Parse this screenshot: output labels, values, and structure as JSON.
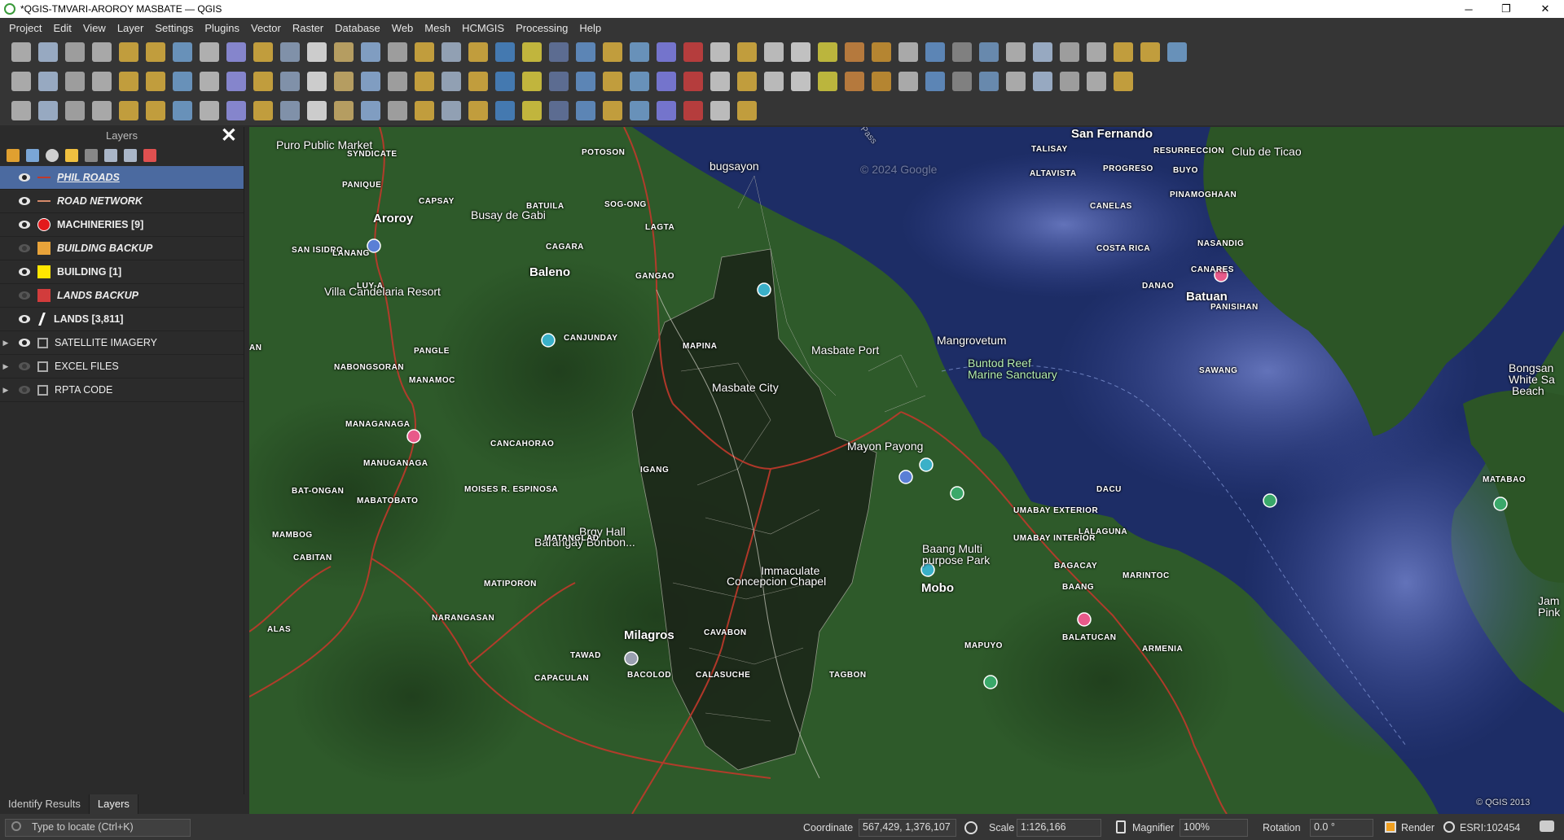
{
  "window": {
    "title": "*QGIS-TMVARI-AROROY MASBATE — QGIS",
    "minimize": "─",
    "maximize": "❐",
    "close": "✕"
  },
  "menu": [
    "Project",
    "Edit",
    "View",
    "Layer",
    "Settings",
    "Plugins",
    "Vector",
    "Raster",
    "Database",
    "Web",
    "Mesh",
    "HCMGIS",
    "Processing",
    "Help"
  ],
  "layers_panel": {
    "title": "Layers",
    "close": "✕",
    "layers": [
      {
        "name": "PHIL ROADS",
        "visible": true,
        "selected": true,
        "style": "line",
        "color": "#c0392b"
      },
      {
        "name": "ROAD NETWORK",
        "visible": true,
        "selected": false,
        "style": "line",
        "color": "#d68a6a"
      },
      {
        "name": "MACHINERIES [9]",
        "visible": true,
        "selected": false,
        "style": "dot",
        "color": "#e31a1c"
      },
      {
        "name": "BUILDING BACKUP",
        "visible": false,
        "selected": false,
        "style": "fill",
        "color": "#e8a33a"
      },
      {
        "name": "BUILDING [1]",
        "visible": true,
        "selected": false,
        "style": "fill",
        "color": "#ffe600"
      },
      {
        "name": "LANDS BACKUP",
        "visible": false,
        "selected": false,
        "style": "fill",
        "color": "#d23c3c"
      },
      {
        "name": "LANDS [3,811]",
        "visible": true,
        "selected": false,
        "style": "pen",
        "color": "#ffffff"
      },
      {
        "name": "SATELLITE IMAGERY",
        "visible": true,
        "selected": false,
        "style": "group",
        "color": "#aaaaaa"
      },
      {
        "name": "EXCEL FILES",
        "visible": false,
        "selected": false,
        "style": "group",
        "color": "#aaaaaa"
      },
      {
        "name": "RPTA CODE",
        "visible": false,
        "selected": false,
        "style": "group",
        "color": "#aaaaaa"
      }
    ]
  },
  "bottom_tabs": [
    "Identify Results",
    "Layers"
  ],
  "map": {
    "big_labels": [
      "San Fernando",
      "Aroroy",
      "Baleno",
      "Batuan",
      "Mobo",
      "Milagros"
    ],
    "place_labels": [
      "Puro Public Market",
      "bugsayon",
      "Busay de Gabi",
      "Villa Candelaria Resort",
      "Masbate Port",
      "Mangrovetum",
      "Buntod Reef",
      "Marine Sanctuary",
      "Mayon Payong",
      "Brgy Hall",
      "Barangay Bonbon...",
      "Baang Multi",
      "purpose Park",
      "Immaculate",
      "Concepcion Chapel",
      "Club de Ticao",
      "Bongsan",
      "White Sa",
      "Beach",
      "Jam",
      "Pink",
      "Masbate City"
    ],
    "barangay_labels": [
      "SYNDICATE",
      "POTOSON",
      "TALISAY",
      "RESURRECCION",
      "ALTAVISTA",
      "PROGRESO",
      "BUYO",
      "PINAMOGHAAN",
      "PANIQUE",
      "CAPSAY",
      "BATUILA",
      "SOG-ONG",
      "LAGTA",
      "CANELAS",
      "SAN ISIDRO",
      "LANANG",
      "CAGARA",
      "COSTA RICA",
      "NASANDIG",
      "GANGAO",
      "CANARES",
      "LUY-A",
      "DANAO",
      "PANISIHAN",
      "CANJUNDAY",
      "PANGLE",
      "NABONGSORAN",
      "MANAMOC",
      "SAWANG",
      "MANAGANAGA",
      "CANCAHORAO",
      "MANUGANAGA",
      "BAT-ONGAN",
      "MABATOBATO",
      "MOISES R. ESPINOSA",
      "IGANG",
      "UMABAY EXTERIOR",
      "DACU",
      "MATABAO",
      "LALAGUNA",
      "UMABAY INTERIOR",
      "MAMBOG",
      "CABITAN",
      "MATANGLAD",
      "BAGACAY",
      "MARINTOC",
      "MATIPORON",
      "BAANG",
      "ALAS",
      "NARANGASAN",
      "CAVABON",
      "BALATUCAN",
      "MAPUYO",
      "ARMENIA",
      "TAWAD",
      "CAPACULAN",
      "BACOLOD",
      "CALASUCHE",
      "TAGBON",
      "MAPINA",
      "AN"
    ],
    "attribution": "&copy; QGIS 2013",
    "watermark": "© 2024 Google",
    "pass_label": "Pass"
  },
  "status": {
    "locate_placeholder": "Type to locate (Ctrl+K)",
    "coordinate_label": "Coordinate",
    "coordinate": "567,429, 1,376,107",
    "scale_label": "Scale",
    "scale": "1:126,166",
    "magnifier_label": "Magnifier",
    "magnifier": "100%",
    "rotation_label": "Rotation",
    "rotation": "0.0 °",
    "render_label": "Render",
    "crs": "ESRI:102454"
  },
  "colors": {
    "sea": "#1d2d66",
    "land": "#2e5a2a",
    "road": "#c0392b",
    "accent": "#4b6aa0"
  }
}
